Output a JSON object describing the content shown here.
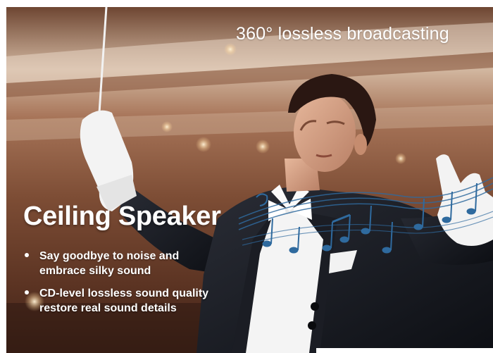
{
  "banner": {
    "tagline": "360° lossless broadcasting",
    "product_title": "Ceiling Speaker",
    "features": [
      {
        "line1": "Say goodbye to noise and",
        "line2": "embrace silky sound"
      },
      {
        "line1": "CD-level lossless sound quality",
        "line2": "restore real sound details"
      }
    ]
  },
  "colors": {
    "text": "#ffffff",
    "background_warm": "#8a5a3e",
    "suit": "#14161c",
    "shirt": "#f4f4f4",
    "music_notes": "#2f6a9e"
  },
  "icons": {
    "bullet": "filled-circle",
    "notes": "music-note-icon"
  }
}
